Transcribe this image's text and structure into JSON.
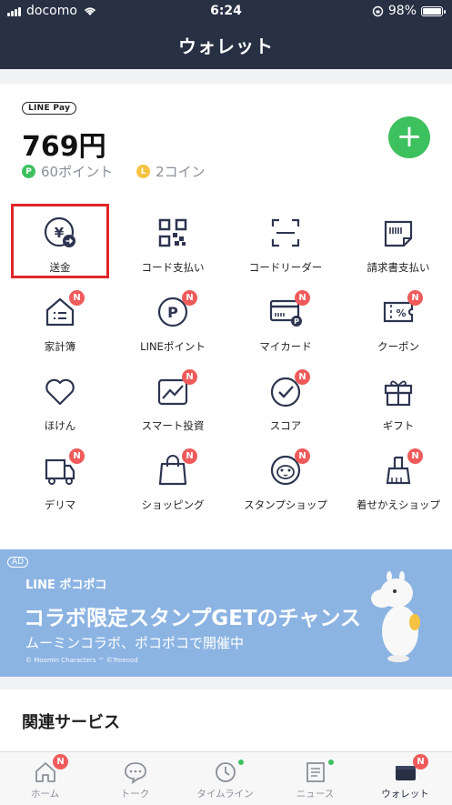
{
  "status_bar": {
    "carrier": "docomo",
    "time": "6:24",
    "battery": "98%"
  },
  "header": {
    "title": "ウォレット"
  },
  "balance": {
    "pay_label": "LINE Pay",
    "amount": "769円",
    "points_label": "60ポイント",
    "coins_label": "2コイン",
    "add_symbol": "+"
  },
  "services": [
    {
      "label": "送金",
      "icon": "yen-transfer-icon"
    },
    {
      "label": "コード支払い",
      "icon": "qr-code-icon"
    },
    {
      "label": "コードリーダー",
      "icon": "scan-frame-icon"
    },
    {
      "label": "請求書支払い",
      "icon": "invoice-icon"
    },
    {
      "label": "家計簿",
      "icon": "household-book-icon",
      "badge": "N"
    },
    {
      "label": "LINEポイント",
      "icon": "line-point-icon",
      "badge": "N"
    },
    {
      "label": "マイカード",
      "icon": "my-card-icon",
      "badge": "N"
    },
    {
      "label": "クーポン",
      "icon": "coupon-icon",
      "badge": "N"
    },
    {
      "label": "ほけん",
      "icon": "heart-icon"
    },
    {
      "label": "スマート投資",
      "icon": "investment-icon",
      "badge": "N"
    },
    {
      "label": "スコア",
      "icon": "score-icon",
      "badge": "N"
    },
    {
      "label": "ギフト",
      "icon": "gift-icon"
    },
    {
      "label": "デリマ",
      "icon": "delivery-icon",
      "badge": "N"
    },
    {
      "label": "ショッピング",
      "icon": "shopping-bag-icon",
      "badge": "N"
    },
    {
      "label": "スタンプショップ",
      "icon": "sticker-shop-icon",
      "badge": "N"
    },
    {
      "label": "着せかえショップ",
      "icon": "theme-shop-icon",
      "badge": "N"
    }
  ],
  "ad": {
    "tag": "AD",
    "brand": "LINE ポコポコ",
    "headline": "コラボ限定スタンプGETのチャンス",
    "subline": "ムーミンコラボ、ポコポコで開催中",
    "copyright": "© Moomin Characters ™ ©Treenod"
  },
  "related_services": {
    "title": "関連サービス"
  },
  "tabs": [
    {
      "label": "ホーム",
      "icon": "home-icon",
      "badge": "N"
    },
    {
      "label": "トーク",
      "icon": "chat-icon"
    },
    {
      "label": "タイムライン",
      "icon": "clock-icon"
    },
    {
      "label": "ニュース",
      "icon": "news-icon"
    },
    {
      "label": "ウォレット",
      "icon": "wallet-icon",
      "badge": "N"
    }
  ],
  "colors": {
    "header": "#283044",
    "accent_green": "#3dc15f",
    "badge_red": "#ef5b5b",
    "highlight_red": "#e0252a",
    "ad_blue": "#8cb4e3"
  }
}
